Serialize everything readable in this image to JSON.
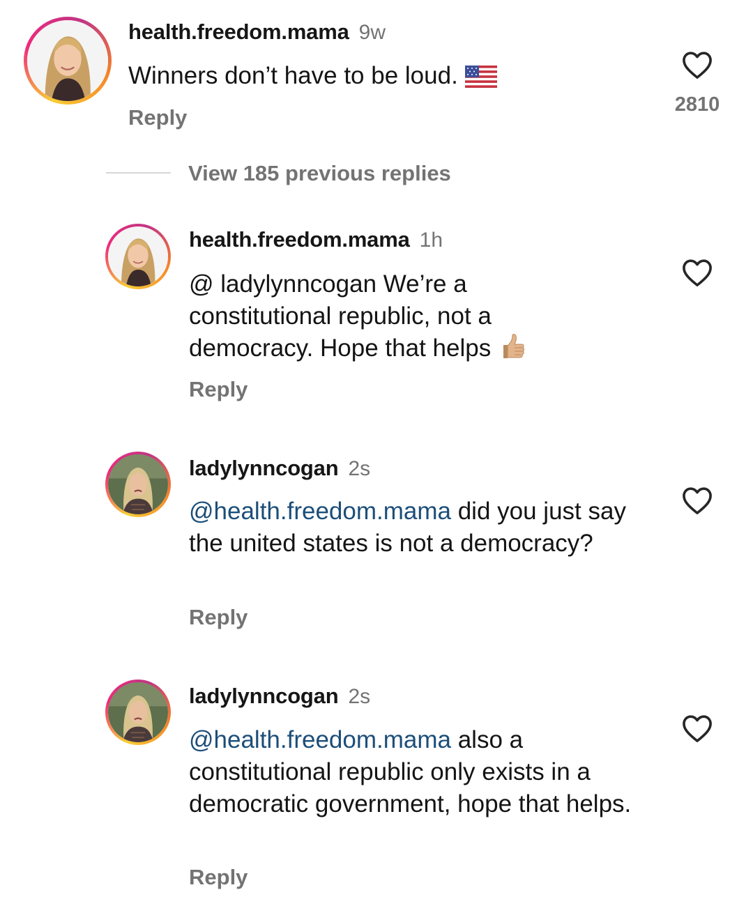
{
  "icons": {
    "like": "heart-outline-icon"
  },
  "colors": {
    "mention": "#1c4e79",
    "muted": "#737373",
    "ring_start": "#f9ce34",
    "ring_mid": "#ee2a7b"
  },
  "top_comment": {
    "username": "health.freedom.mama",
    "time": "9w",
    "text": "Winners don’t have to be loud.",
    "emoji": "us-flag-emoji",
    "reply_label": "Reply",
    "likes": "2810"
  },
  "view_replies_label": "View 185 previous replies",
  "replies": [
    {
      "username": "health.freedom.mama",
      "time": "1h",
      "text": "@ ladylynncogan We’re a constitutional republic, not a democracy. Hope that helps",
      "emoji": "thumbs-up-emoji",
      "reply_label": "Reply"
    },
    {
      "username": "ladylynncogan",
      "time": "2s",
      "mention": "@health.freedom.mama",
      "text": " did you just say the united states is not a democracy?",
      "reply_label": "Reply"
    },
    {
      "username": "ladylynncogan",
      "time": "2s",
      "mention": "@health.freedom.mama",
      "text": " also a constitutional republic only exists in a democratic government, hope that helps.",
      "reply_label": "Reply"
    }
  ]
}
